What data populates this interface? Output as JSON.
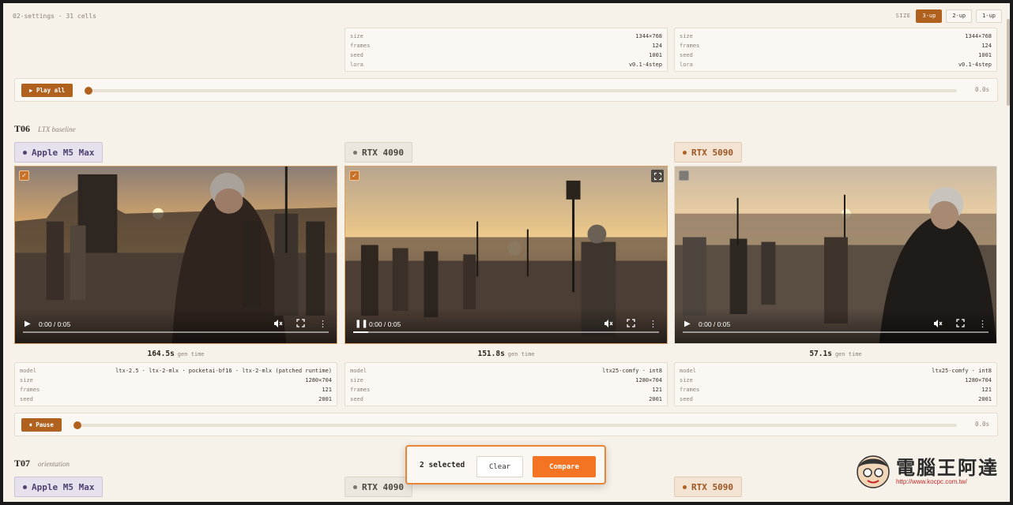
{
  "header": {
    "crumb": "02-settings · 31 cells",
    "size_label": "SIZE",
    "size_options": [
      "3-up",
      "2-up",
      "1-up"
    ],
    "size_active": "3-up"
  },
  "prev_meta": [
    {
      "rows": [
        [
          "size",
          "1344×768"
        ],
        [
          "frames",
          "124"
        ],
        [
          "seed",
          "1001"
        ],
        [
          "lora",
          "v0.1-4step"
        ]
      ]
    },
    {
      "rows": [
        [
          "size",
          "1344×768"
        ],
        [
          "frames",
          "124"
        ],
        [
          "seed",
          "1001"
        ],
        [
          "lora",
          "v0.1-4step"
        ]
      ]
    }
  ],
  "prev_playbar": {
    "button": "▶ Play all",
    "time": "0.0s",
    "progress": 0
  },
  "t06": {
    "id": "T06",
    "desc": "LTX baseline",
    "cells": [
      {
        "device": "Apple M5 Max",
        "selected": true,
        "time": "0:00 / 0:05",
        "progress": 0,
        "gen": "164.5s",
        "gen_unit": "gen time",
        "rows": [
          [
            "model",
            "ltx-2.5 · ltx-2-mlx · pocketai-bf16 · ltx-2-mlx (patched runtime)"
          ],
          [
            "size",
            "1280×704"
          ],
          [
            "frames",
            "121"
          ],
          [
            "seed",
            "2001"
          ]
        ]
      },
      {
        "device": "RTX 4090",
        "selected": true,
        "time": "0:00 / 0:05",
        "progress": 0.05,
        "gen": "151.8s",
        "gen_unit": "gen time",
        "rows": [
          [
            "model",
            "ltx25-comfy · int8"
          ],
          [
            "size",
            "1280×704"
          ],
          [
            "frames",
            "121"
          ],
          [
            "seed",
            "2001"
          ]
        ]
      },
      {
        "device": "RTX 5090",
        "selected": false,
        "time": "0:00 / 0:05",
        "progress": 0,
        "gen": "57.1s",
        "gen_unit": "gen time",
        "rows": [
          [
            "model",
            "ltx25-comfy · int8"
          ],
          [
            "size",
            "1280×704"
          ],
          [
            "frames",
            "121"
          ],
          [
            "seed",
            "2001"
          ]
        ]
      }
    ],
    "playbar": {
      "button": "⏸ Pause",
      "time": "0.0s",
      "progress": 0
    }
  },
  "t07": {
    "id": "T07",
    "desc": "orientation",
    "devices": [
      "Apple M5 Max",
      "RTX 4090",
      "RTX 5090"
    ]
  },
  "selection": {
    "count_label": "2 selected",
    "clear": "Clear",
    "compare": "Compare"
  },
  "watermark": {
    "title": "電腦王阿達",
    "url": "http://www.kocpc.com.tw/"
  },
  "colors": {
    "accent": "#b1611e",
    "compare": "#f37423",
    "apple": "#4f4170"
  },
  "icons": [
    "play-icon",
    "pause-icon",
    "mute-icon",
    "fullscreen-icon",
    "more-icon",
    "check-icon",
    "expand-icon"
  ]
}
